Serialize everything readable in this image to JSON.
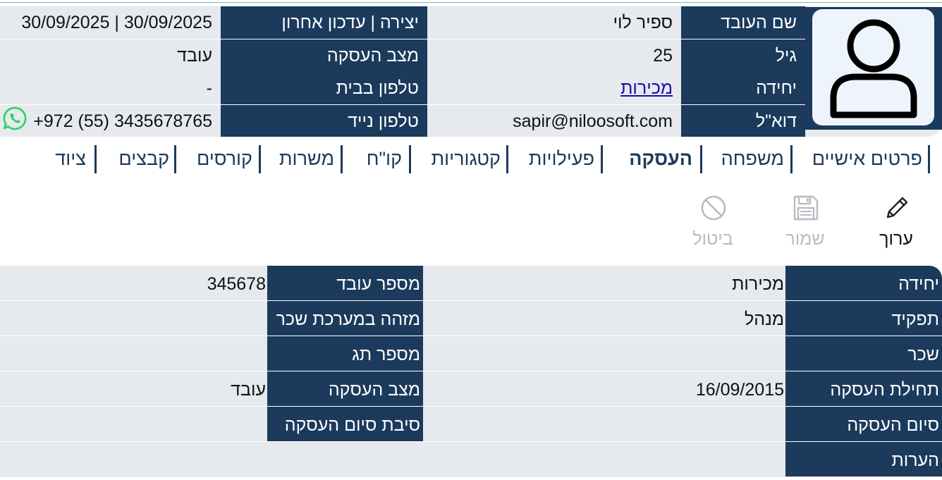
{
  "header": {
    "employee_name_label": "שם העובד",
    "employee_name": "ספיר לוי",
    "age_label": "גיל",
    "age": "25",
    "unit_label": "יחידה",
    "unit": "מכירות",
    "email_label": "דוא\"ל",
    "email": "sapir@niloosoft.com",
    "created_updated_label": "יצירה | עדכון אחרון",
    "created_updated": "30/09/2025 | 30/09/2025",
    "employment_status_label": "מצב העסקה",
    "employment_status": "עובד",
    "home_phone_label": "טלפון בבית",
    "home_phone": "-",
    "mobile_phone_label": "טלפון נייד",
    "mobile_phone": "+972 (55) 3435678765"
  },
  "tabs": [
    {
      "label": "פרטים אישיים",
      "active": false
    },
    {
      "label": "משפחה",
      "active": false
    },
    {
      "label": "העסקה",
      "active": true
    },
    {
      "label": "פעילויות",
      "active": false
    },
    {
      "label": "קטגוריות",
      "active": false
    },
    {
      "label": "קו\"ח",
      "active": false
    },
    {
      "label": "משרות",
      "active": false
    },
    {
      "label": "קורסים",
      "active": false
    },
    {
      "label": "קבצים",
      "active": false
    },
    {
      "label": "ציוד",
      "active": false
    }
  ],
  "toolbar": {
    "edit_label": "ערוך",
    "save_label": "שמור",
    "cancel_label": "ביטול",
    "edit_icon": "pencil-icon",
    "save_icon": "floppy-disk-icon",
    "cancel_icon": "prohibited-icon"
  },
  "details": {
    "unit_label": "יחידה",
    "unit": "מכירות",
    "role_label": "תפקיד",
    "role": "מנהל",
    "salary_label": "שכר",
    "salary": "",
    "start_label": "תחילת העסקה",
    "start": "16/09/2015",
    "end_label": "סיום העסקה",
    "end": "",
    "notes_label": "הערות",
    "notes": "",
    "employee_number_label": "מספר עובד",
    "employee_number": "345678",
    "payroll_id_label": "מזהה במערכת שכר",
    "payroll_id": "",
    "tag_number_label": "מספר תג",
    "tag_number": "",
    "employment_status_label": "מצב העסקה",
    "employment_status": "עובד",
    "end_reason_label": "סיבת סיום העסקה",
    "end_reason": ""
  },
  "colors": {
    "label_background": "#1b3a5c",
    "row_background": "#e6e9ee",
    "link": "#1a0dab",
    "whatsapp": "#25d366",
    "disabled_text": "#b8bcc2"
  }
}
